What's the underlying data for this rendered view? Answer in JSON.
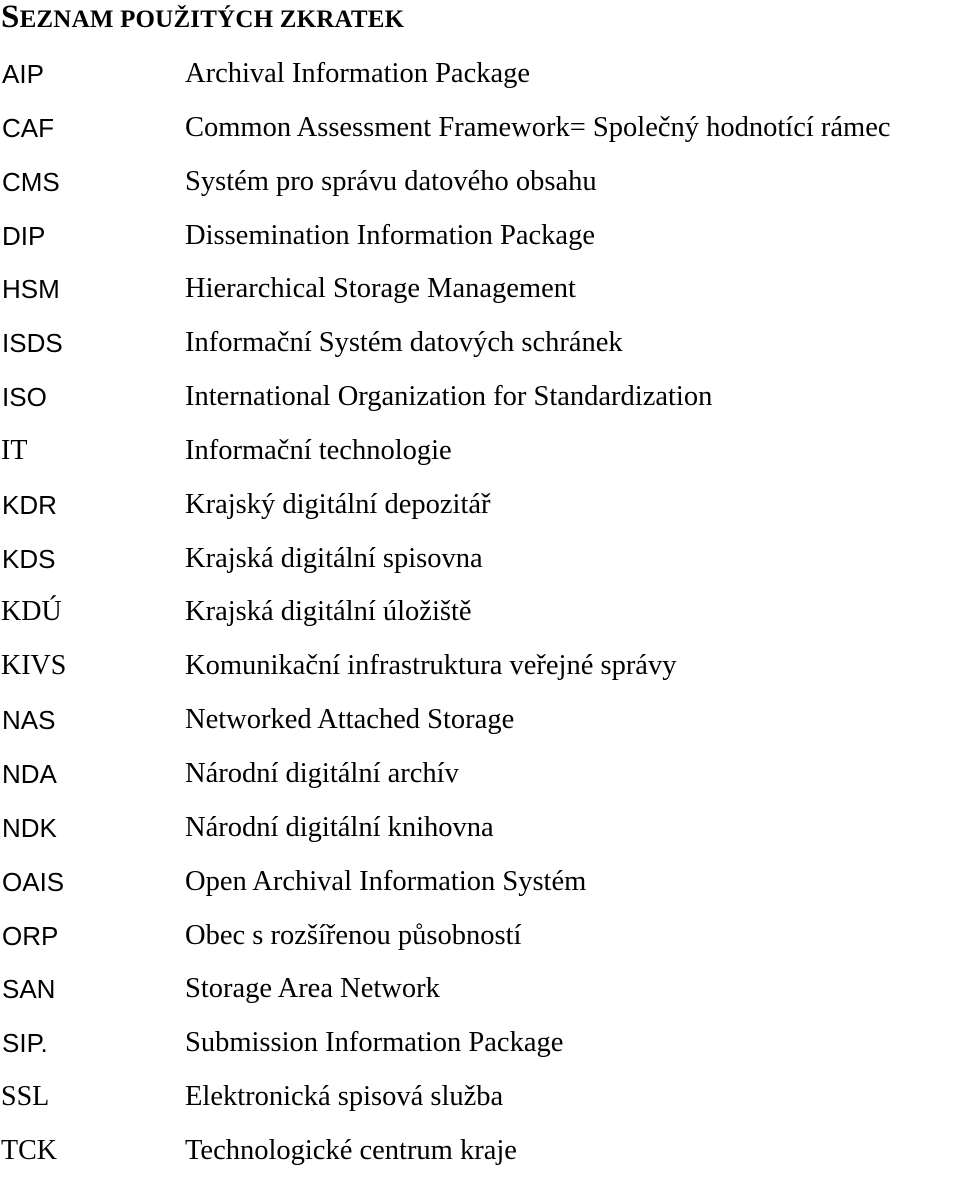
{
  "document": {
    "title_first_letter": "S",
    "title_rest": "EZNAM POUŽITÝCH ZKRATEK",
    "abbreviations": [
      {
        "abbr": "AIP",
        "desc": "Archival Information Package"
      },
      {
        "abbr": "CAF",
        "desc": "Common Assessment Framework= Společný hodnotící rámec"
      },
      {
        "abbr": "CMS",
        "desc": "Systém pro správu datového obsahu"
      },
      {
        "abbr": "DIP",
        "desc": "Dissemination Information Package"
      },
      {
        "abbr": "HSM",
        "desc": "Hierarchical Storage Management"
      },
      {
        "abbr": "ISDS",
        "desc": "Informační Systém datových schránek"
      },
      {
        "abbr": "ISO",
        "desc": "International Organization for Standardization"
      },
      {
        "abbr": "IT",
        "desc": "Informační technologie"
      },
      {
        "abbr": "KDR",
        "desc": "Krajský digitální depozitář"
      },
      {
        "abbr": "KDS",
        "desc": "Krajská digitální spisovna"
      },
      {
        "abbr": "KDÚ",
        "desc": "Krajská digitální úložiště"
      },
      {
        "abbr": "KIVS",
        "desc": "Komunikační infrastruktura veřejné správy"
      },
      {
        "abbr": "NAS",
        "desc": "Networked Attached Storage"
      },
      {
        "abbr": "NDA",
        "desc": "Národní digitální archív"
      },
      {
        "abbr": "NDK",
        "desc": "Národní digitální knihovna"
      },
      {
        "abbr": "OAIS",
        "desc": "Open Archival Information Systém"
      },
      {
        "abbr": "ORP",
        "desc": "Obec s rozšířenou působností"
      },
      {
        "abbr": "SAN",
        "desc": "Storage Area Network"
      },
      {
        "abbr": "SIP.",
        "desc": "Submission Information Package"
      },
      {
        "abbr": "SSL",
        "desc": "Elektronická spisová služba"
      },
      {
        "abbr": "TCK",
        "desc": "Technologické centrum kraje"
      }
    ]
  }
}
